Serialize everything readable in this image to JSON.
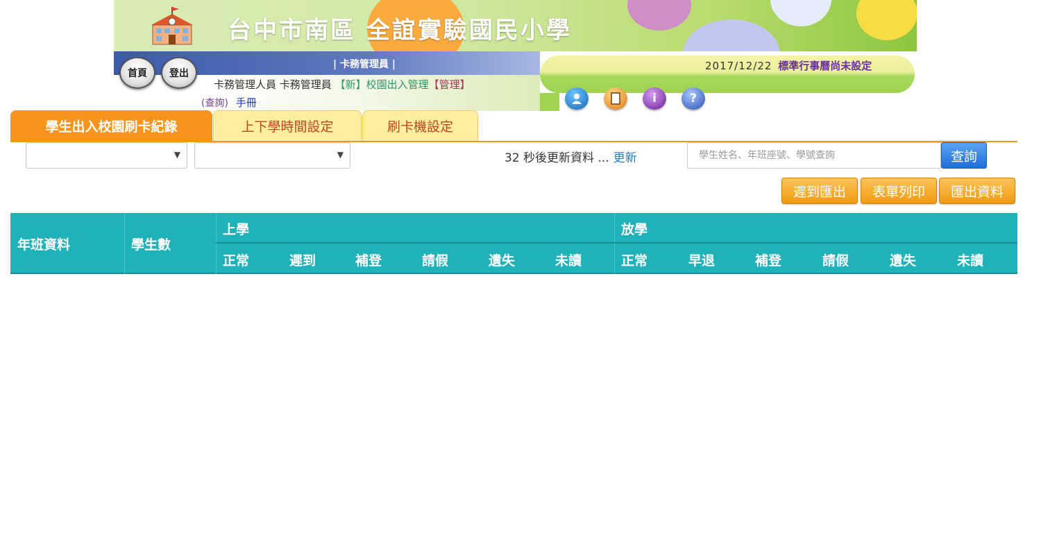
{
  "banner": {
    "school_name": "台中市南區 全誼實驗國民小學",
    "school_icon": "school-building-icon"
  },
  "nav": {
    "home_label": "首頁",
    "logout_label": "登出",
    "role_title": "| 卡務管理員 |",
    "user_prefix": "卡務管理人員 卡務管理員",
    "user_new": "【新】",
    "user_module": "校園出入管理",
    "user_manage": "【管理】",
    "query_label": "(查詢)",
    "manual_label": "手冊",
    "date": "2017/12/22",
    "calendar_note": "標準行事曆尚未設定",
    "icons": [
      "user-profile-icon",
      "document-icon",
      "info-icon",
      "help-icon"
    ]
  },
  "tabs": [
    {
      "label": "學生出入校園刷卡紀錄",
      "active": true
    },
    {
      "label": "上下學時間設定",
      "active": false
    },
    {
      "label": "刷卡機設定",
      "active": false
    }
  ],
  "filters": {
    "select_1_value": "",
    "select_2_value": "",
    "refresh_text": "32 秒後更新資料 ...",
    "refresh_link": "更新",
    "search_placeholder": "學生姓名、年班座號、學號查詢",
    "search_button": "查詢"
  },
  "actions": {
    "late_export": "遲到匯出",
    "print_form": "表單列印",
    "export_data": "匯出資料"
  },
  "table": {
    "col_class": "年班資料",
    "col_students": "學生數",
    "group_morning": "上學",
    "group_afternoon": "放學",
    "morning_cols": [
      "正常",
      "遲到",
      "補登",
      "請假",
      "遺失",
      "未讀"
    ],
    "afternoon_cols": [
      "正常",
      "早退",
      "補登",
      "請假",
      "遺失",
      "未讀"
    ],
    "rows": []
  },
  "colors": {
    "tab_active": "#f7941e",
    "table_header": "#1fb2b8",
    "action_button": "#f09a10",
    "search_button": "#1f6ed8"
  }
}
